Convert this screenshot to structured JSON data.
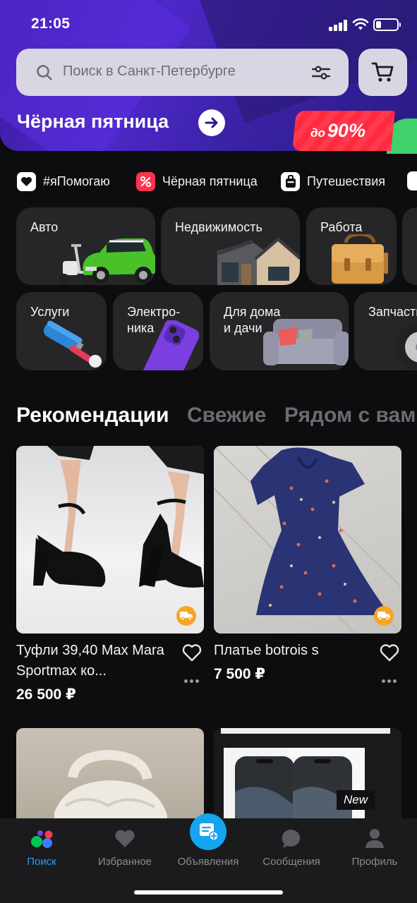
{
  "status_bar": {
    "time": "21:05"
  },
  "search": {
    "placeholder": "Поиск в Санкт-Петербурге"
  },
  "promo": {
    "title": "Чёрная пятница",
    "badge_prefix": "до",
    "badge_value": "90%"
  },
  "chips": [
    {
      "label": "#яПомогаю",
      "icon": "heart-icon"
    },
    {
      "label": "Чёрная пятница",
      "icon": "percent-icon"
    },
    {
      "label": "Путешествия",
      "icon": "suitcase-icon"
    }
  ],
  "categories": [
    {
      "label": "Авто"
    },
    {
      "label": "Недвижимость"
    },
    {
      "label": "Работа"
    },
    {
      "label": "Услуги"
    },
    {
      "label": "Электро-\nника"
    },
    {
      "label": "Для дома\nи дачи"
    },
    {
      "label": "Запчасти"
    }
  ],
  "tabs": [
    "Рекомендации",
    "Свежие",
    "Рядом с вами"
  ],
  "listings": [
    {
      "title": "Туфли 39,40 Max Mara Sportmax ко...",
      "price": "26 500 ₽"
    },
    {
      "title": "Платье botrois s",
      "price": "7 500 ₽"
    },
    {
      "title": "",
      "price": ""
    },
    {
      "title": "",
      "price": "",
      "badge": "New"
    }
  ],
  "nav": [
    {
      "label": "Поиск",
      "active": true
    },
    {
      "label": "Избранное"
    },
    {
      "label": "Объявления"
    },
    {
      "label": "Сообщения"
    },
    {
      "label": "Профиль"
    }
  ],
  "colors": {
    "accent": "#1aa3ff",
    "promo_red": "#ff2a40",
    "hero_purple": "#4d28c9"
  }
}
